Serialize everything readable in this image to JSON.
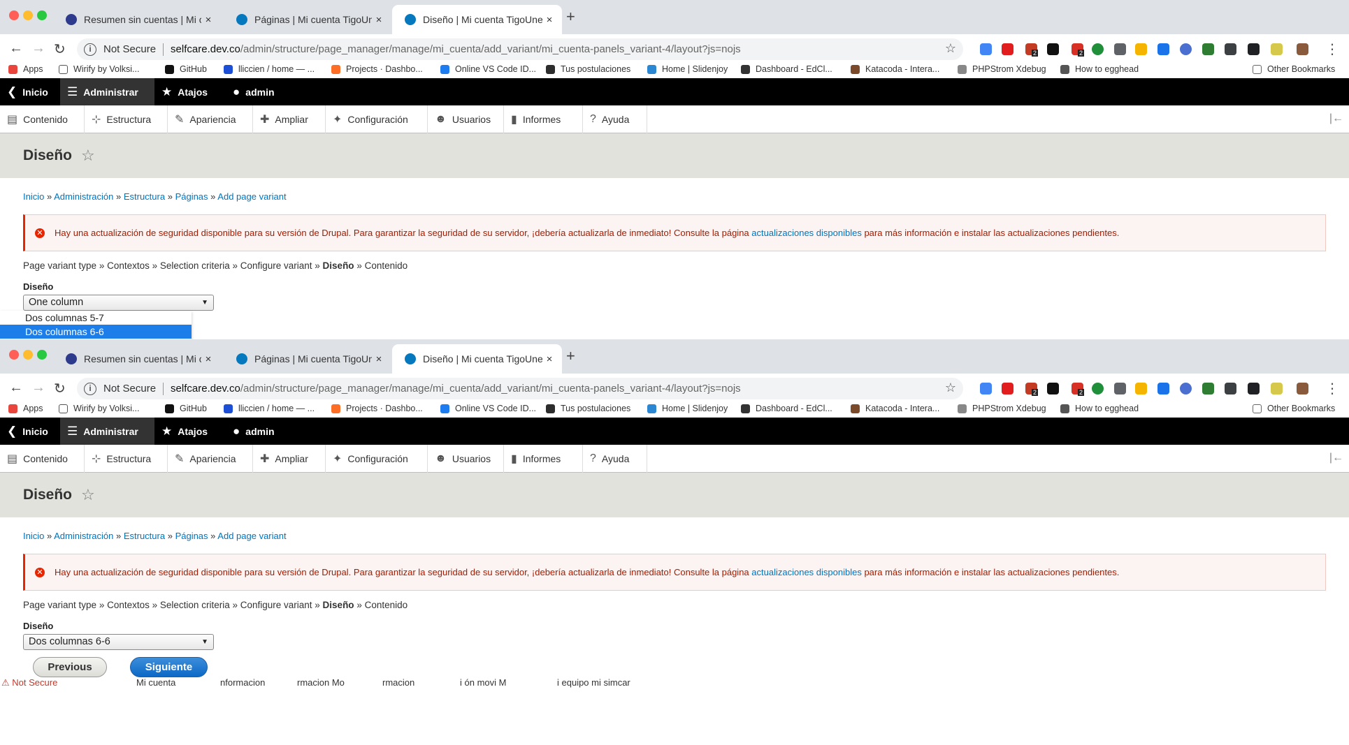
{
  "browser": {
    "tabs": [
      {
        "title": "Resumen sin cuentas | Mi cuen",
        "favicon_color": "#2e3a8c",
        "active": false
      },
      {
        "title": "Páginas | Mi cuenta TigoUne",
        "favicon_color": "#0678be",
        "active": false
      },
      {
        "title": "Diseño | Mi cuenta TigoUne",
        "favicon_color": "#0678be",
        "active": true
      }
    ],
    "tab_close": "×",
    "new_tab": "+",
    "back": "←",
    "forward": "→",
    "reload": "↻",
    "security_label": "Not Secure",
    "url_host": "selfcare.dev.co",
    "url_path": "/admin/structure/page_manager/manage/mi_cuenta/add_variant/mi_cuenta-panels_variant-4/layout?js=nojs",
    "bookmark_star": "☆",
    "menu": "⋮",
    "extension_colors": [
      "#4285f4",
      "#e11d1d",
      "#c23b22",
      "#111111",
      "#d93025",
      "#1f8f3a",
      "#5f6368",
      "#f5b400",
      "#1a73e8",
      "#4a6fd1",
      "#2e7d32",
      "#3c4043",
      "#202124",
      "#d5c84b",
      "#8a5a3c"
    ],
    "extension_badges": [
      "2",
      "2"
    ],
    "bookmarks": [
      {
        "label": "Apps",
        "icon": "apps-grid-icon",
        "color": "#e8453c"
      },
      {
        "label": "Wirify by Volksi...",
        "icon": "page-icon",
        "color": "#ffffff"
      },
      {
        "label": "GitHub",
        "icon": "github-icon",
        "color": "#111111"
      },
      {
        "label": "lliccien / home — ...",
        "icon": "shield-icon",
        "color": "#1d4fd6"
      },
      {
        "label": "Projects · Dashbo...",
        "icon": "gitlab-icon",
        "color": "#fc6d26"
      },
      {
        "label": "Online VS Code ID...",
        "icon": "bolt-icon",
        "color": "#1c7cf0"
      },
      {
        "label": "Tus postulaciones",
        "icon": "job-icon",
        "color": "#2d2d2d"
      },
      {
        "label": "Home | Slidenjoy",
        "icon": "bird-icon",
        "color": "#2b87d1"
      },
      {
        "label": "Dashboard - EdCl...",
        "icon": "avatar-icon",
        "color": "#333333"
      },
      {
        "label": "Katacoda - Intera...",
        "icon": "bear-icon",
        "color": "#7a4a2b"
      },
      {
        "label": "PHPStrom Xdebug",
        "icon": "folder-icon",
        "color": "#888888"
      },
      {
        "label": "How to egghead",
        "icon": "egghead-icon",
        "color": "#555555"
      }
    ],
    "other_bookmarks": "Other Bookmarks"
  },
  "toolbar": {
    "items": [
      {
        "label": "Inicio",
        "icon": "back-circle-icon"
      },
      {
        "label": "Administrar",
        "icon": "hamburger-icon"
      },
      {
        "label": "Atajos",
        "icon": "star-icon"
      },
      {
        "label": "admin",
        "icon": "user-icon"
      }
    ]
  },
  "tray": {
    "items": [
      {
        "label": "Contenido",
        "icon": "file-icon"
      },
      {
        "label": "Estructura",
        "icon": "sitemap-icon"
      },
      {
        "label": "Apariencia",
        "icon": "paintbrush-icon"
      },
      {
        "label": "Ampliar",
        "icon": "puzzle-icon"
      },
      {
        "label": "Configuración",
        "icon": "wrench-icon"
      },
      {
        "label": "Usuarios",
        "icon": "people-icon"
      },
      {
        "label": "Informes",
        "icon": "bar-chart-icon"
      },
      {
        "label": "Ayuda",
        "icon": "help-icon"
      }
    ],
    "orientation_toggle": "|←"
  },
  "page": {
    "title": "Diseño",
    "shortcut_star": "☆",
    "breadcrumb": [
      "Inicio",
      "Administración",
      "Estructura",
      "Páginas",
      "Add page variant"
    ],
    "breadcrumb_sep": " » ",
    "message": {
      "icon": "✕",
      "before": "Hay una actualización de seguridad disponible para su versión de Drupal. Para garantizar la seguridad de su servidor, ¡debería actualizarla de inmediato! Consulte la página ",
      "link": "actualizaciones disponibles",
      "after": " para más información e instalar las actualizaciones pendientes."
    },
    "steps": [
      "Page variant type",
      "Contextos",
      "Selection criteria",
      "Configure variant",
      "Diseño",
      "Contenido"
    ],
    "current_step": "Diseño",
    "layout_label": "Diseño",
    "caret": "▼"
  },
  "screen1": {
    "select_value": "One column",
    "dropdown_options": [
      "Dos columnas 5-7",
      "Dos columnas 6-6"
    ],
    "highlighted_option": "Dos columnas 6-6"
  },
  "screen2": {
    "select_value": "Dos columnas 6-6",
    "previous_label": "Previous",
    "next_label": "Siguiente",
    "glitch_fragments": [
      "⚠ Not Secure",
      "Mi cuenta",
      "nformacion",
      "rmacion Mo",
      "rmacion",
      "i ón movi M",
      "i equipo mi simcar"
    ]
  }
}
